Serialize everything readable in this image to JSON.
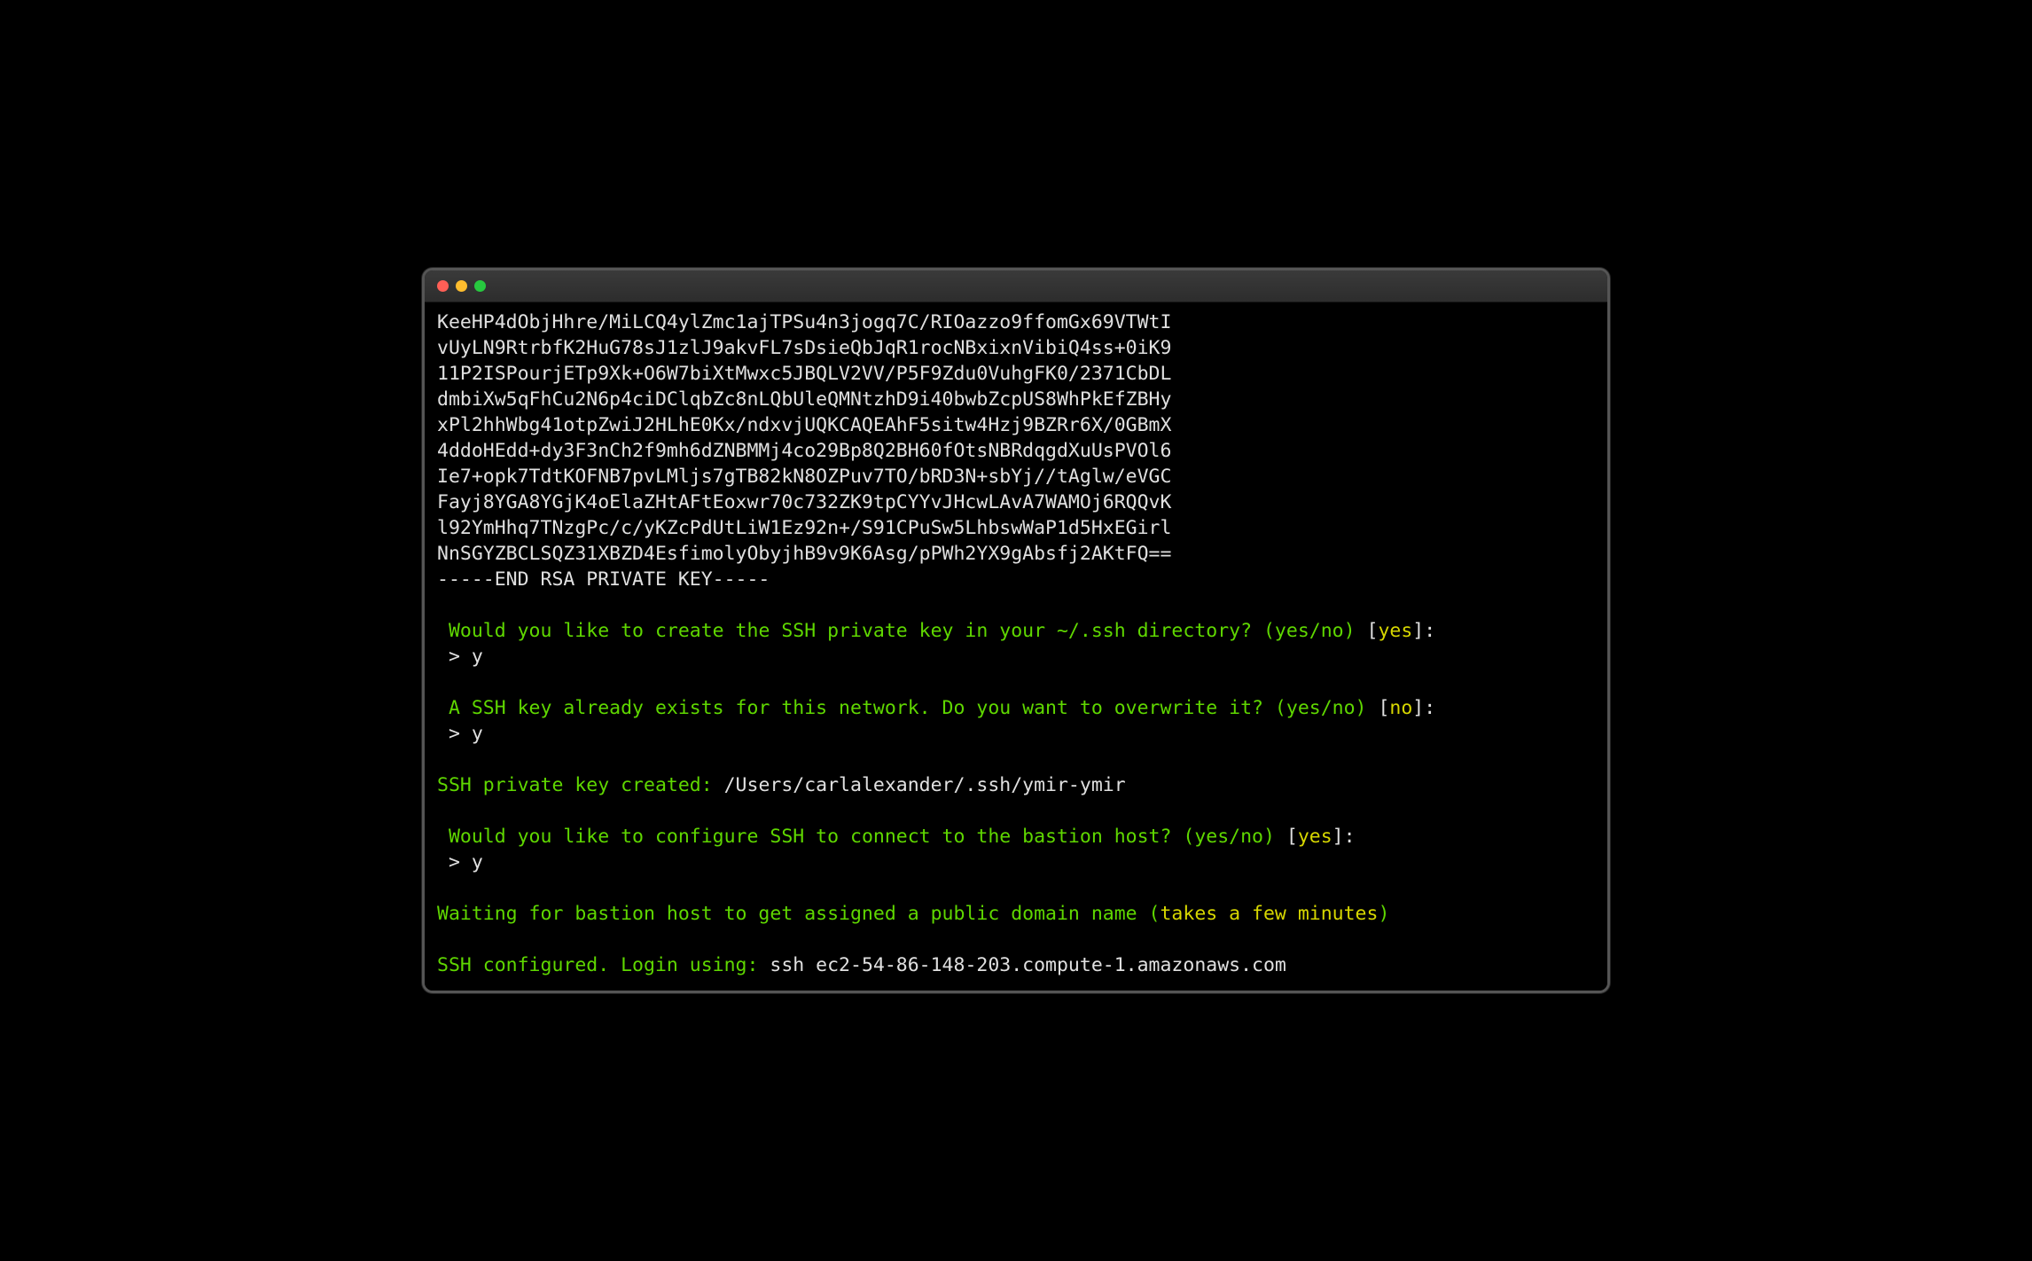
{
  "key_lines": [
    "KeeHP4dObjHhre/MiLCQ4ylZmc1ajTPSu4n3jogq7C/RIOazzo9ffomGx69VTWtI",
    "vUyLN9RtrbfK2HuG78sJ1zlJ9akvFL7sDsieQbJqR1rocNBxixnVibiQ4ss+0iK9",
    "11P2ISPourjETp9Xk+O6W7biXtMwxc5JBQLV2VV/P5F9Zdu0VuhgFK0/2371CbDL",
    "dmbiXw5qFhCu2N6p4ciDClqbZc8nLQbUleQMNtzhD9i40bwbZcpUS8WhPkEfZBHy",
    "xPl2hhWbg41otpZwiJ2HLhE0Kx/ndxvjUQKCAQEAhF5sitw4Hzj9BZRr6X/0GBmX",
    "4ddoHEdd+dy3F3nCh2f9mh6dZNBMMj4co29Bp8Q2BH60fOtsNBRdqgdXuUsPVOl6",
    "Ie7+opk7TdtKOFNB7pvLMljs7gTB82kN8OZPuv7TO/bRD3N+sbYj//tAglw/eVGC",
    "Fayj8YGA8YGjK4oElaZHtAFtEoxwr70c732ZK9tpCYYvJHcwLAvA7WAMOj6RQQvK",
    "l92YmHhq7TNzgPc/c/yKZcPdUtLiW1Ez92n+/S91CPuSw5LhbswWaP1d5HxEGirl",
    "NnSGYZBCLSQZ31XBZD4EsfimolyObyjhB9v9K6Asg/pPWh2YX9gAbsfj2AKtFQ=="
  ],
  "key_footer": "-----END RSA PRIVATE KEY-----",
  "q1_prompt": "Would you like to create the SSH private key in your ~/.ssh directory? (yes/no) ",
  "q1_default": "yes",
  "prompt_marker": " > ",
  "answer": "y",
  "q2_prompt": "A SSH key already exists for this network. Do you want to overwrite it? (yes/no) ",
  "q2_default": "no",
  "created_label": "SSH private key created: ",
  "created_path": "/Users/carlalexander/.ssh/ymir-ymir",
  "q3_prompt": "Would you like to configure SSH to connect to the bastion host? (yes/no) ",
  "q3_default": "yes",
  "waiting_prefix": "Waiting for bastion host to get assigned a public domain name (",
  "waiting_note": "takes a few minutes",
  "waiting_suffix": ")",
  "configured_label": "SSH configured. Login using: ",
  "configured_cmd": "ssh ec2-54-86-148-203.compute-1.amazonaws.com",
  "bracket_open": "[",
  "bracket_close": "]:"
}
